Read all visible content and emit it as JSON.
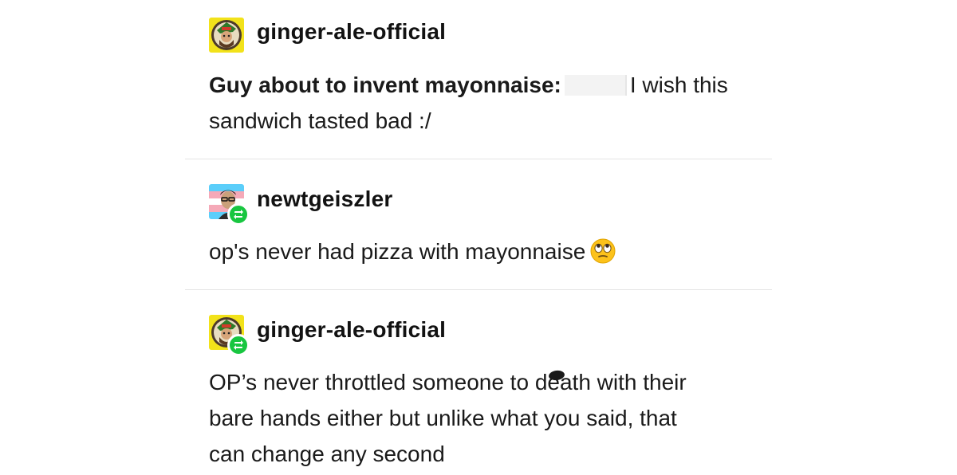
{
  "posts": [
    {
      "username": "ginger-ale-official",
      "text_bold": "Guy about to invent mayonnaise:",
      "text_rest_line1": "I wish this",
      "text_line2": "sandwich tasted bad :/",
      "avatar_icon": "ginger-ale-avatar-icon",
      "is_reblog": false
    },
    {
      "username": "newtgeiszler",
      "text": "op's never had pizza with mayonnaise",
      "emoji_icon": "face-with-rolling-eyes-icon",
      "avatar_icon": "newtgeiszler-avatar-icon",
      "is_reblog": true
    },
    {
      "username": "ginger-ale-official",
      "text_line1_a": "OP’s never throttled someone to d",
      "text_line1_b": "ea",
      "text_line1_c": "th with their",
      "text_line2": "bare hands either but unlike what you said, that",
      "text_line3": "can change any second",
      "avatar_icon": "ginger-ale-avatar-icon",
      "is_reblog": true
    }
  ],
  "colors": {
    "reblog_green": "#18c640",
    "divider": "#e4e4e4",
    "text": "#1a1a1a"
  }
}
